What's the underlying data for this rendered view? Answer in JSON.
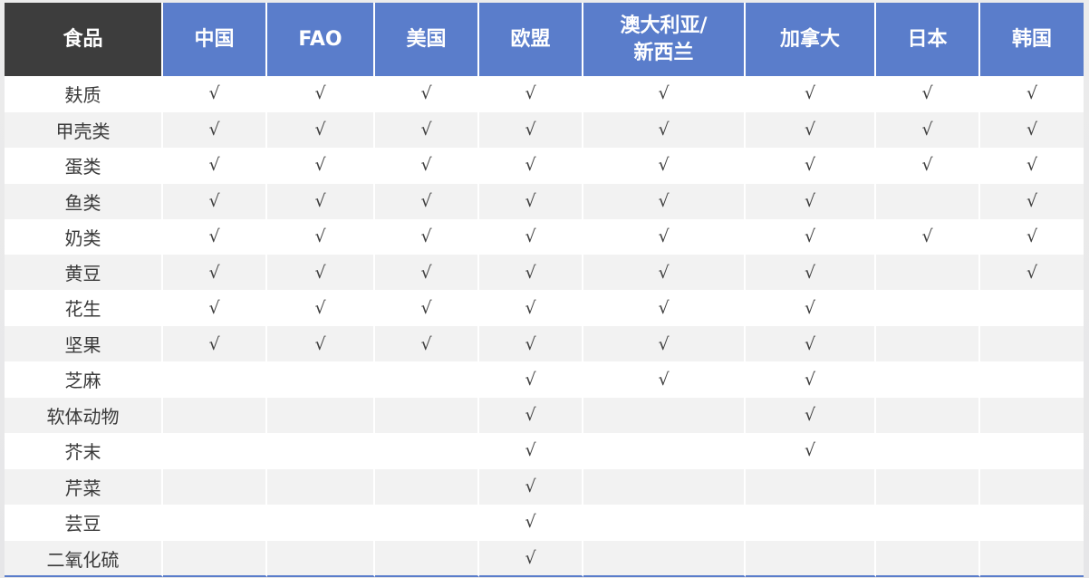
{
  "table": {
    "headers": [
      "食品",
      "中国",
      "FAO",
      "美国",
      "欧盟",
      "澳大利亚/\n新西兰",
      "加拿大",
      "日本",
      "韩国"
    ],
    "header_lines": {
      "col5_line1": "澳大利亚/",
      "col5_line2": "新西兰"
    },
    "check_symbol": "√",
    "rows": [
      {
        "food": "麸质",
        "marks": [
          "√",
          "√",
          "√",
          "√",
          "√",
          "√",
          "√",
          "√"
        ]
      },
      {
        "food": "甲壳类",
        "marks": [
          "√",
          "√",
          "√",
          "√",
          "√",
          "√",
          "√",
          "√"
        ]
      },
      {
        "food": "蛋类",
        "marks": [
          "√",
          "√",
          "√",
          "√",
          "√",
          "√",
          "√",
          "√"
        ]
      },
      {
        "food": "鱼类",
        "marks": [
          "√",
          "√",
          "√",
          "√",
          "√",
          "√",
          "",
          "√"
        ]
      },
      {
        "food": "奶类",
        "marks": [
          "√",
          "√",
          "√",
          "√",
          "√",
          "√",
          "√",
          "√"
        ]
      },
      {
        "food": "黄豆",
        "marks": [
          "√",
          "√",
          "√",
          "√",
          "√",
          "√",
          "",
          "√"
        ]
      },
      {
        "food": "花生",
        "marks": [
          "√",
          "√",
          "√",
          "√",
          "√",
          "√",
          "",
          ""
        ]
      },
      {
        "food": "坚果",
        "marks": [
          "√",
          "√",
          "√",
          "√",
          "√",
          "√",
          "",
          ""
        ]
      },
      {
        "food": "芝麻",
        "marks": [
          "",
          "",
          "",
          "√",
          "√",
          "√",
          "",
          ""
        ]
      },
      {
        "food": "软体动物",
        "marks": [
          "",
          "",
          "",
          "√",
          "",
          "√",
          "",
          ""
        ]
      },
      {
        "food": "芥末",
        "marks": [
          "",
          "",
          "",
          "√",
          "",
          "√",
          "",
          ""
        ]
      },
      {
        "food": "芹菜",
        "marks": [
          "",
          "",
          "",
          "√",
          "",
          "",
          "",
          ""
        ]
      },
      {
        "food": "芸豆",
        "marks": [
          "",
          "",
          "",
          "√",
          "",
          "",
          "",
          ""
        ]
      },
      {
        "food": "二氧化硫",
        "marks": [
          "",
          "",
          "",
          "√",
          "",
          "",
          "",
          ""
        ]
      }
    ]
  },
  "colors": {
    "header_first_bg": "#3d3d3d",
    "header_bg": "#5a7dcb",
    "row_alt_bg": "#f2f2f2",
    "bottom_rule": "#5a7dcb"
  }
}
